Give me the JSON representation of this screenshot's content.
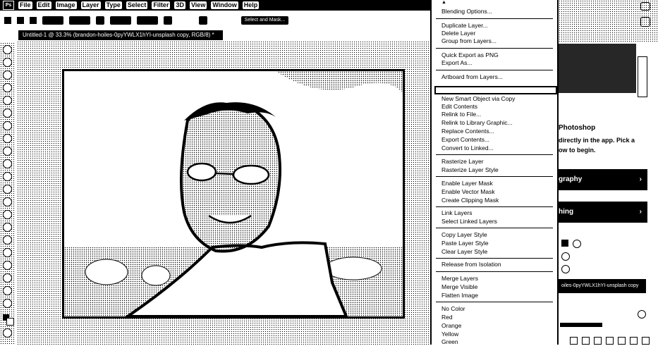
{
  "menubar": {
    "logo": "Ps",
    "items": [
      "File",
      "Edit",
      "Image",
      "Layer",
      "Type",
      "Select",
      "Filter",
      "3D",
      "View",
      "Window",
      "Help"
    ]
  },
  "options": {
    "select_and_mask": "Select and Mask..."
  },
  "document": {
    "tab_title": "Untitled-1 @ 33.3% (brandon-hoiles-0pyYWLX1hYI-unsplash copy, RGB/8) *"
  },
  "context_menu": {
    "items": [
      {
        "label": "Blending Options...",
        "group": 0
      },
      {
        "label": "Duplicate Layer...",
        "group": 1
      },
      {
        "label": "Delete Layer",
        "group": 1
      },
      {
        "label": "Group from Layers...",
        "group": 1
      },
      {
        "label": "Quick Export as PNG",
        "group": 2
      },
      {
        "label": "Export As...",
        "group": 2
      },
      {
        "label": "Artboard from Layers...",
        "group": 3
      },
      {
        "label": "New Smart Object via Copy",
        "group": 4
      },
      {
        "label": "Edit Contents",
        "group": 4
      },
      {
        "label": "Relink to File...",
        "group": 4
      },
      {
        "label": "Relink to Library Graphic...",
        "group": 4
      },
      {
        "label": "Replace Contents...",
        "group": 4
      },
      {
        "label": "Export Contents...",
        "group": 4
      },
      {
        "label": "Convert to Linked...",
        "group": 4
      },
      {
        "label": "Rasterize Layer",
        "group": 5
      },
      {
        "label": "Rasterize Layer Style",
        "group": 5
      },
      {
        "label": "Enable Layer Mask",
        "group": 6
      },
      {
        "label": "Enable Vector Mask",
        "group": 6
      },
      {
        "label": "Create Clipping Mask",
        "group": 6
      },
      {
        "label": "Link Layers",
        "group": 7
      },
      {
        "label": "Select Linked Layers",
        "group": 7
      },
      {
        "label": "Copy Layer Style",
        "group": 8
      },
      {
        "label": "Paste Layer Style",
        "group": 8
      },
      {
        "label": "Clear Layer Style",
        "group": 8
      },
      {
        "label": "Release from Isolation",
        "group": 9
      },
      {
        "label": "Merge Layers",
        "group": 10
      },
      {
        "label": "Merge Visible",
        "group": 10
      },
      {
        "label": "Flatten Image",
        "group": 10
      },
      {
        "label": "No Color",
        "group": 11
      },
      {
        "label": "Red",
        "group": 11
      },
      {
        "label": "Orange",
        "group": 11
      },
      {
        "label": "Yellow",
        "group": 11
      },
      {
        "label": "Green",
        "group": 11
      }
    ]
  },
  "right_panel": {
    "learn_title": "Photoshop",
    "learn_line1": "directly in the app. Pick a",
    "learn_line2": "ow to begin.",
    "card1": "graphy",
    "card2": "hing",
    "layer_name": "oiles-0pyYWLX1hYI-unsplash copy"
  }
}
